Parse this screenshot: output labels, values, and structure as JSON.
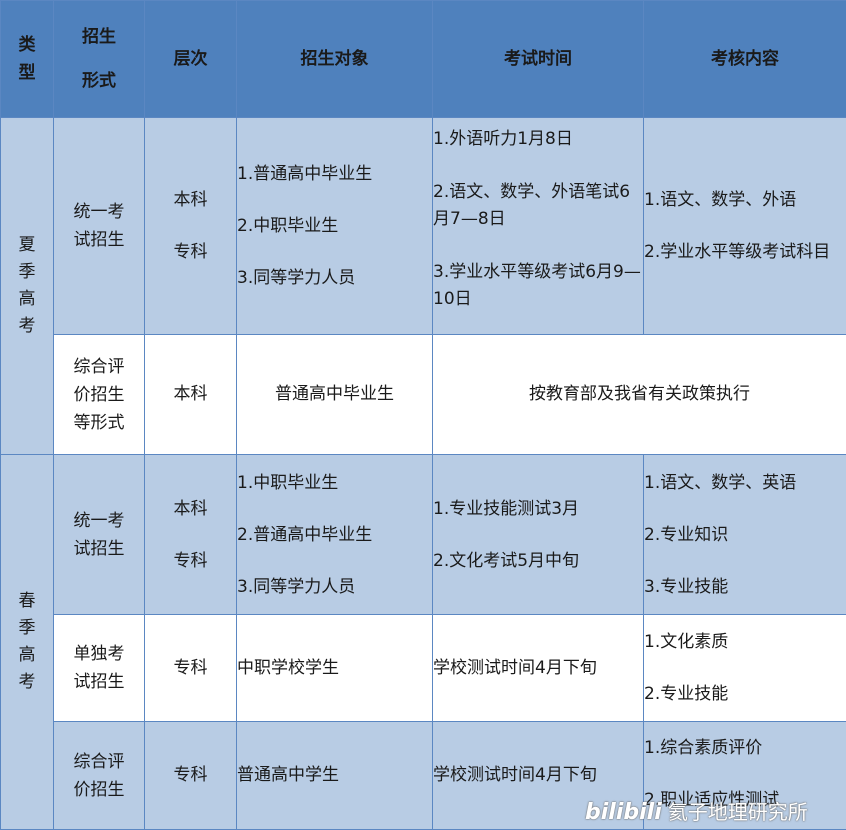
{
  "header": {
    "type": "类\n型",
    "form_l1": "招生",
    "form_l2": "形式",
    "level": "层次",
    "target": "招生对象",
    "time": "考试时间",
    "content": "考核内容"
  },
  "summer": {
    "type": "夏季高考",
    "row1": {
      "form": "统一考\n试招生",
      "level1": "本科",
      "level2": "专科",
      "targets": [
        "1.普通高中毕业生",
        "2.中职毕业生",
        "3.同等学力人员"
      ],
      "times": [
        "1.外语听力1月8日",
        "2.语文、数学、外语笔试6月7—8日",
        "3.学业水平等级考试6月9—10日"
      ],
      "contents": [
        "1.语文、数学、外语",
        "2.学业水平等级考试科目"
      ]
    },
    "row2": {
      "form": "综合评\n价招生\n等形式",
      "level": "本科",
      "target": "普通高中毕业生",
      "policy": "按教育部及我省有关政策执行"
    }
  },
  "spring": {
    "type": "春季高考",
    "row1": {
      "form": "统一考\n试招生",
      "level1": "本科",
      "level2": "专科",
      "targets": [
        "1.中职毕业生",
        "2.普通高中毕业生",
        "3.同等学力人员"
      ],
      "times": [
        "1.专业技能测试3月",
        "2.文化考试5月中旬"
      ],
      "contents": [
        "1.语文、数学、英语",
        "2.专业知识",
        "3.专业技能"
      ]
    },
    "row2": {
      "form": "单独考\n试招生",
      "level": "专科",
      "target": "中职学校学生",
      "time": "学校测试时间4月下旬",
      "contents": [
        "1.文化素质",
        "2.专业技能"
      ]
    },
    "row3": {
      "form": "综合评\n价招生",
      "level": "专科",
      "target": "普通高中学生",
      "time": "学校测试时间4月下旬",
      "contents": [
        "1.综合素质评价",
        "2.职业适应性测试"
      ]
    }
  },
  "watermark": {
    "logo": "bilibili",
    "text": "氦子地理研究所"
  }
}
